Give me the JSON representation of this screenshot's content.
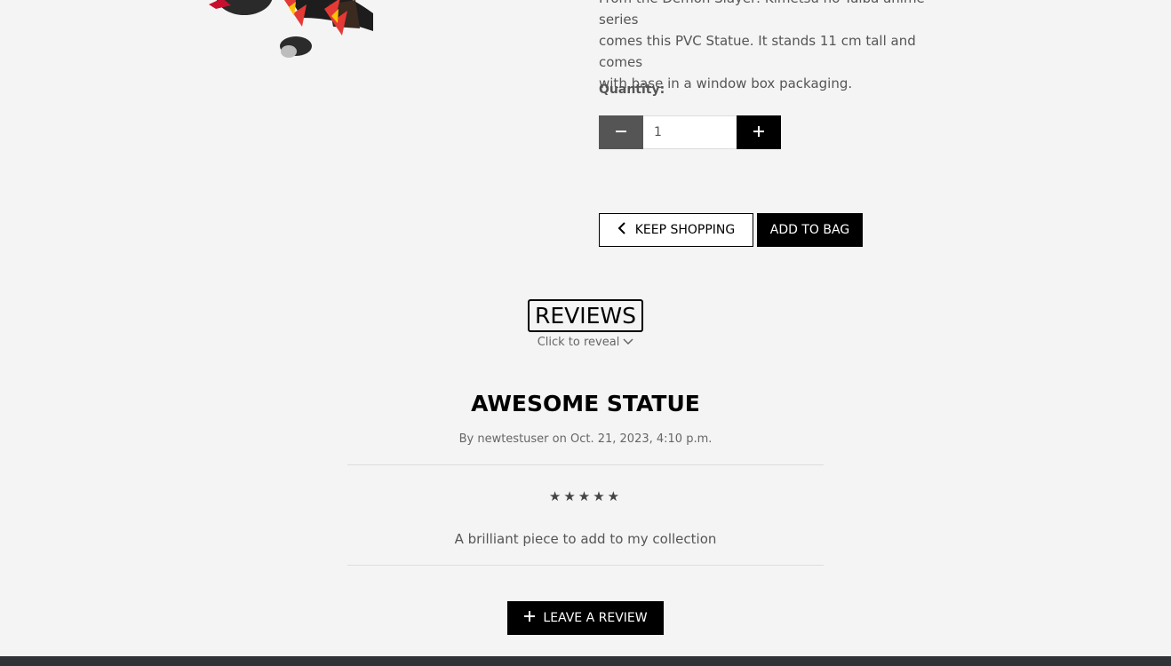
{
  "product": {
    "description_lines": [
      "From the Demon Slayer: Kimetsu no Yaiba anime series",
      "comes this PVC Statue. It stands 11 cm tall and comes",
      "with base in a window box packaging."
    ]
  },
  "quantity": {
    "label": "Quantity:",
    "value": "1",
    "decrement_icon": "minus-icon",
    "increment_icon": "plus-icon"
  },
  "actions": {
    "keep_shopping": "KEEP SHOPPING",
    "keep_shopping_icon": "chevron-left-icon",
    "add_to_bag": "ADD TO BAG"
  },
  "reviews": {
    "heading": "REVIEWS",
    "reveal": "Click to reveal",
    "reveal_icon": "chevron-down-icon",
    "items": [
      {
        "title": "AWESOME STATUE",
        "meta": "By newtestuser on Oct. 21, 2023, 4:10 p.m.",
        "stars": "★★★★★",
        "rating": 5,
        "body": "A brilliant piece to add to my collection"
      }
    ],
    "leave_review": "LEAVE A REVIEW",
    "leave_review_icon": "plus-icon"
  },
  "colors": {
    "background": "#f4f4f4",
    "button_dark": "#000000",
    "button_grey": "#555555",
    "footer": "#2f3338"
  }
}
